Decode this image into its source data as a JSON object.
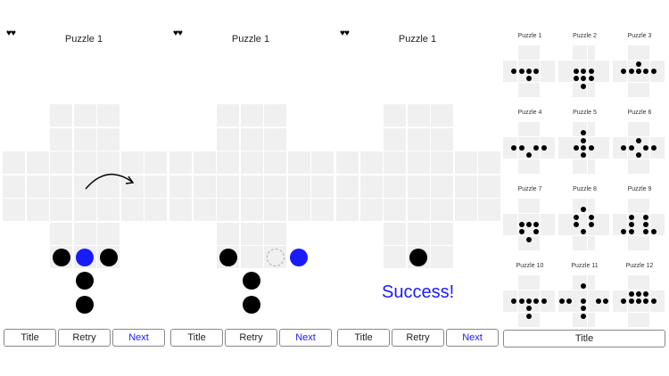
{
  "panels": [
    {
      "hearts": "♥♥",
      "title": "Puzzle 1",
      "pegs": [
        {
          "col": 2,
          "row": 3,
          "state": "normal"
        },
        {
          "col": 3,
          "row": 3,
          "state": "selected"
        },
        {
          "col": 4,
          "row": 3,
          "state": "normal"
        },
        {
          "col": 3,
          "row": 4,
          "state": "normal"
        },
        {
          "col": 3,
          "row": 5,
          "state": "normal"
        }
      ],
      "move_arrow": true,
      "buttons": {
        "title": "Title",
        "retry": "Retry",
        "next": "Next"
      }
    },
    {
      "hearts": "♥♥",
      "title": "Puzzle 1",
      "pegs": [
        {
          "col": 2,
          "row": 3,
          "state": "normal"
        },
        {
          "col": 4,
          "row": 3,
          "state": "empty"
        },
        {
          "col": 5,
          "row": 3,
          "state": "selected"
        },
        {
          "col": 3,
          "row": 4,
          "state": "normal"
        },
        {
          "col": 3,
          "row": 5,
          "state": "normal"
        }
      ],
      "move_arrow": false,
      "buttons": {
        "title": "Title",
        "retry": "Retry",
        "next": "Next"
      }
    },
    {
      "hearts": "♥♥",
      "title": "Puzzle 1",
      "pegs": [
        {
          "col": 3,
          "row": 3,
          "state": "normal"
        }
      ],
      "move_arrow": false,
      "success": "Success!",
      "buttons": {
        "title": "Title",
        "retry": "Retry",
        "next": "Next"
      }
    }
  ],
  "puzzle_select": {
    "title_button": "Title",
    "puzzles": [
      {
        "label": "Puzzle 1",
        "pegs": [
          [
            1,
            3
          ],
          [
            2,
            3
          ],
          [
            3,
            3
          ],
          [
            4,
            3
          ],
          [
            3,
            4
          ]
        ]
      },
      {
        "label": "Puzzle 2",
        "pegs": [
          [
            2,
            3
          ],
          [
            3,
            3
          ],
          [
            4,
            3
          ],
          [
            2,
            4
          ],
          [
            3,
            4
          ],
          [
            4,
            4
          ],
          [
            3,
            5
          ]
        ]
      },
      {
        "label": "Puzzle 3",
        "pegs": [
          [
            3,
            2
          ],
          [
            2,
            3
          ],
          [
            3,
            3
          ],
          [
            4,
            3
          ],
          [
            5,
            3
          ],
          [
            1,
            3
          ]
        ]
      },
      {
        "label": "Puzzle 4",
        "pegs": [
          [
            1,
            3
          ],
          [
            2,
            3
          ],
          [
            4,
            3
          ],
          [
            5,
            3
          ],
          [
            3,
            4
          ]
        ]
      },
      {
        "label": "Puzzle 5",
        "pegs": [
          [
            3,
            1
          ],
          [
            3,
            2
          ],
          [
            2,
            3
          ],
          [
            3,
            3
          ],
          [
            4,
            3
          ],
          [
            3,
            4
          ]
        ]
      },
      {
        "label": "Puzzle 6",
        "pegs": [
          [
            3,
            2
          ],
          [
            1,
            3
          ],
          [
            2,
            3
          ],
          [
            4,
            3
          ],
          [
            5,
            3
          ],
          [
            3,
            4
          ]
        ]
      },
      {
        "label": "Puzzle 7",
        "pegs": [
          [
            2,
            3
          ],
          [
            3,
            3
          ],
          [
            4,
            3
          ],
          [
            2,
            4
          ],
          [
            4,
            4
          ],
          [
            3,
            5
          ]
        ]
      },
      {
        "label": "Puzzle 8",
        "pegs": [
          [
            3,
            1
          ],
          [
            2,
            2
          ],
          [
            4,
            2
          ],
          [
            2,
            3
          ],
          [
            4,
            3
          ],
          [
            3,
            4
          ]
        ]
      },
      {
        "label": "Puzzle 9",
        "pegs": [
          [
            2,
            2
          ],
          [
            4,
            2
          ],
          [
            2,
            3
          ],
          [
            4,
            3
          ],
          [
            1,
            4
          ],
          [
            2,
            4
          ],
          [
            4,
            4
          ],
          [
            5,
            4
          ]
        ]
      },
      {
        "label": "Puzzle 10",
        "pegs": [
          [
            1,
            3
          ],
          [
            2,
            3
          ],
          [
            3,
            3
          ],
          [
            4,
            3
          ],
          [
            5,
            3
          ],
          [
            3,
            4
          ],
          [
            3,
            5
          ]
        ]
      },
      {
        "label": "Puzzle 11",
        "pegs": [
          [
            3,
            1
          ],
          [
            0,
            3
          ],
          [
            1,
            3
          ],
          [
            5,
            3
          ],
          [
            6,
            3
          ],
          [
            3,
            3
          ],
          [
            3,
            4
          ],
          [
            3,
            5
          ]
        ]
      },
      {
        "label": "Puzzle 12",
        "pegs": [
          [
            2,
            2
          ],
          [
            3,
            2
          ],
          [
            4,
            2
          ],
          [
            1,
            3
          ],
          [
            2,
            3
          ],
          [
            3,
            3
          ],
          [
            4,
            3
          ],
          [
            5,
            3
          ]
        ]
      }
    ]
  },
  "colors": {
    "selected": "#1a1aff",
    "peg": "#000000",
    "cell": "#f0f0f0",
    "accent": "#1a1aff"
  }
}
